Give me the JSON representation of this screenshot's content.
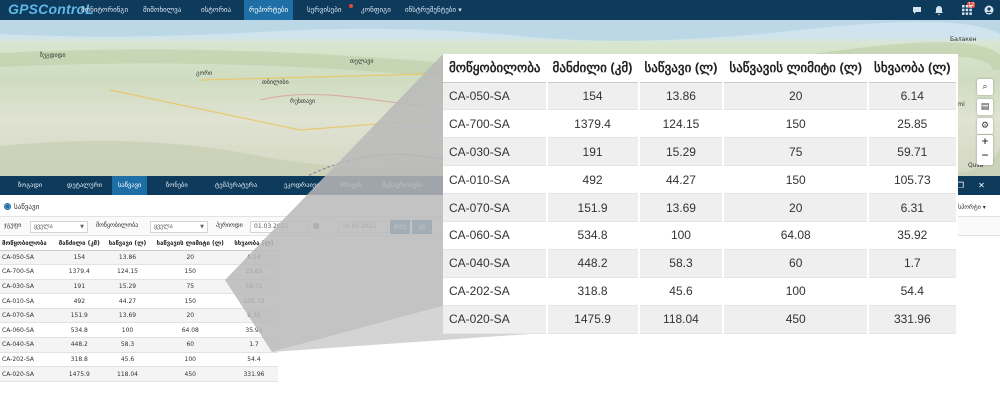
{
  "app": {
    "logo": "GPSControL"
  },
  "nav": {
    "items": [
      "მონიტორინგი",
      "მიმოხილვა",
      "ისტორია",
      "რეპორტები",
      "სერვისები",
      "კონფიგი",
      "ინსტრუმენტები ▾"
    ],
    "active_index": 3,
    "notification_count": "12"
  },
  "map": {
    "labels": {
      "tbilisi": "თბილისი",
      "rustavi": "რუსთავი",
      "gori": "გორი",
      "telavi": "თელავი",
      "zugdidi": "ზუგდიდი",
      "magharami": "Magharami",
      "belokani": "Балакен",
      "qusar": "Qusa"
    }
  },
  "panel": {
    "tabs": [
      "ზოგადი",
      "დეტალური",
      "საწვავი",
      "ზონები",
      "ტემპერატურა",
      "ეკოდრაივი",
      "ძრავის",
      "მგზავრობები"
    ],
    "active_index": 2
  },
  "filters": {
    "radio_label": "საწვავი",
    "group_label": "ჯგუფი",
    "group_value": "ყველა",
    "vehicle_label": "მოწყობილობა",
    "vehicle_value": "ყველა",
    "period_label": "პერიოდი",
    "date_from": "01.03.2021",
    "date_to": "19.03.2021",
    "btn1": "დღე",
    "btn2": "კვ",
    "export_label": "ექსპორტი ▾"
  },
  "table": {
    "headers": [
      "მოწყობილობა",
      "მანძილი (კმ)",
      "საწვავი (ლ)",
      "საწვავის ლიმიტი (ლ)",
      "სხვაობა (ლ)"
    ],
    "rows": [
      [
        "CA-050-SA",
        "154",
        "13.86",
        "20",
        "6.14"
      ],
      [
        "CA-700-SA",
        "1379.4",
        "124.15",
        "150",
        "25.85"
      ],
      [
        "CA-030-SA",
        "191",
        "15.29",
        "75",
        "59.71"
      ],
      [
        "CA-010-SA",
        "492",
        "44.27",
        "150",
        "105.73"
      ],
      [
        "CA-070-SA",
        "151.9",
        "13.69",
        "20",
        "6.31"
      ],
      [
        "CA-060-SA",
        "534.8",
        "100",
        "64.08",
        "35.92"
      ],
      [
        "CA-040-SA",
        "448.2",
        "58.3",
        "60",
        "1.7"
      ],
      [
        "CA-202-SA",
        "318.8",
        "45.6",
        "100",
        "54.4"
      ],
      [
        "CA-020-SA",
        "1475.9",
        "118.04",
        "450",
        "331.96"
      ]
    ]
  }
}
